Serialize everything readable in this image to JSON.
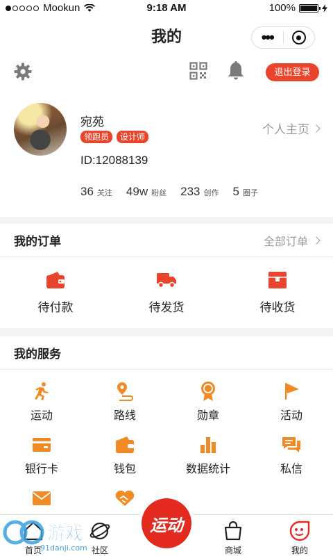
{
  "status_bar": {
    "carrier": "Mookun",
    "time": "9:18 AM",
    "battery": "100%"
  },
  "header": {
    "title": "我的"
  },
  "toolbar": {
    "logout_label": "退出登录"
  },
  "profile": {
    "name": "宛苑",
    "tags": [
      "领跑员",
      "设计师"
    ],
    "homepage_label": "个人主页",
    "id_text": "ID:12088139",
    "stats": [
      {
        "value": "36",
        "label": "关注"
      },
      {
        "value": "49w",
        "label": "粉丝"
      },
      {
        "value": "233",
        "label": "创作"
      },
      {
        "value": "5",
        "label": "圈子"
      }
    ]
  },
  "orders": {
    "title": "我的订单",
    "more_label": "全部订单",
    "items": [
      {
        "label": "待付款",
        "icon": "wallet-icon"
      },
      {
        "label": "待发货",
        "icon": "truck-icon"
      },
      {
        "label": "待收货",
        "icon": "box-icon"
      }
    ]
  },
  "services": {
    "title": "我的服务",
    "items": [
      {
        "label": "运动",
        "icon": "runner-icon"
      },
      {
        "label": "路线",
        "icon": "route-icon"
      },
      {
        "label": "勋章",
        "icon": "medal-icon"
      },
      {
        "label": "活动",
        "icon": "flag-icon"
      },
      {
        "label": "银行卡",
        "icon": "bank-card-icon"
      },
      {
        "label": "钱包",
        "icon": "wallet-icon"
      },
      {
        "label": "数据统计",
        "icon": "bar-chart-icon"
      },
      {
        "label": "私信",
        "icon": "message-icon"
      },
      {
        "label": "",
        "icon": "mail-icon"
      },
      {
        "label": "",
        "icon": "handshake-icon"
      }
    ]
  },
  "tabbar": {
    "items": [
      {
        "label": "首页",
        "icon": "home-icon"
      },
      {
        "label": "社区",
        "icon": "planet-icon"
      },
      {
        "label": "商城",
        "icon": "bag-icon"
      },
      {
        "label": "我的",
        "icon": "smile-icon"
      }
    ],
    "center_label": "运动"
  },
  "watermark": {
    "text": "游戏",
    "subtext": "91danji.com"
  },
  "colors": {
    "accent": "#e8452c",
    "icon_orange": "#f08a24",
    "center_red": "#e22a1e"
  }
}
